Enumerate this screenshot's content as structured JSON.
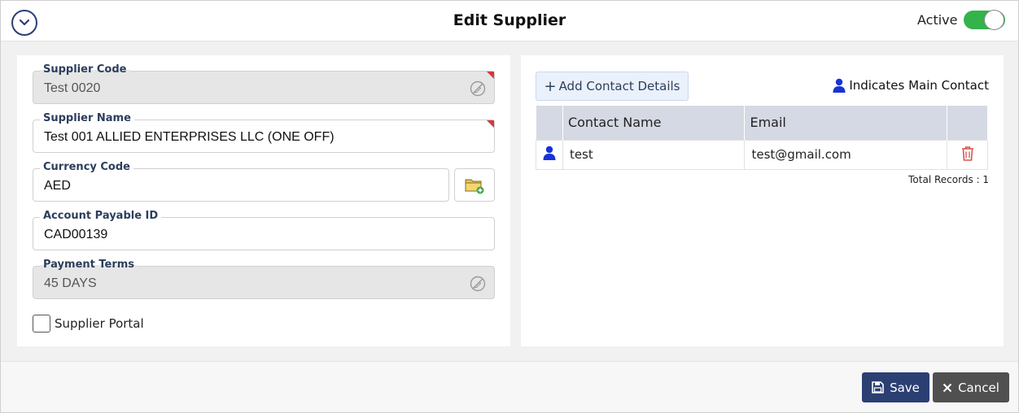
{
  "header": {
    "title": "Edit Supplier",
    "active_label": "Active",
    "active": true
  },
  "form": {
    "supplier_code": {
      "label": "Supplier Code",
      "value": "Test 0020"
    },
    "supplier_name": {
      "label": "Supplier Name",
      "value": "Test 001 ALLIED ENTERPRISES LLC (ONE OFF)"
    },
    "currency_code": {
      "label": "Currency Code",
      "value": "AED"
    },
    "account_payable_id": {
      "label": "Account Payable ID",
      "value": "CAD00139"
    },
    "payment_terms": {
      "label": "Payment Terms",
      "value": "45 DAYS"
    },
    "supplier_portal": {
      "label": "Supplier Portal",
      "checked": false
    }
  },
  "contacts": {
    "add_label": "Add Contact Details",
    "legend": "Indicates Main Contact",
    "columns": [
      "",
      "Contact Name",
      "Email",
      ""
    ],
    "rows": [
      {
        "name": "test",
        "email": "test@gmail.com",
        "main": true
      }
    ],
    "total": "Total Records : 1"
  },
  "footer": {
    "save_label": "Save",
    "cancel_label": "Cancel"
  },
  "colors": {
    "primary": "#2b3f73",
    "toggle_on": "#34b24c",
    "required_marker": "#d23a3a",
    "delete_icon": "#d9534f",
    "main_contact_icon": "#1733d6"
  }
}
